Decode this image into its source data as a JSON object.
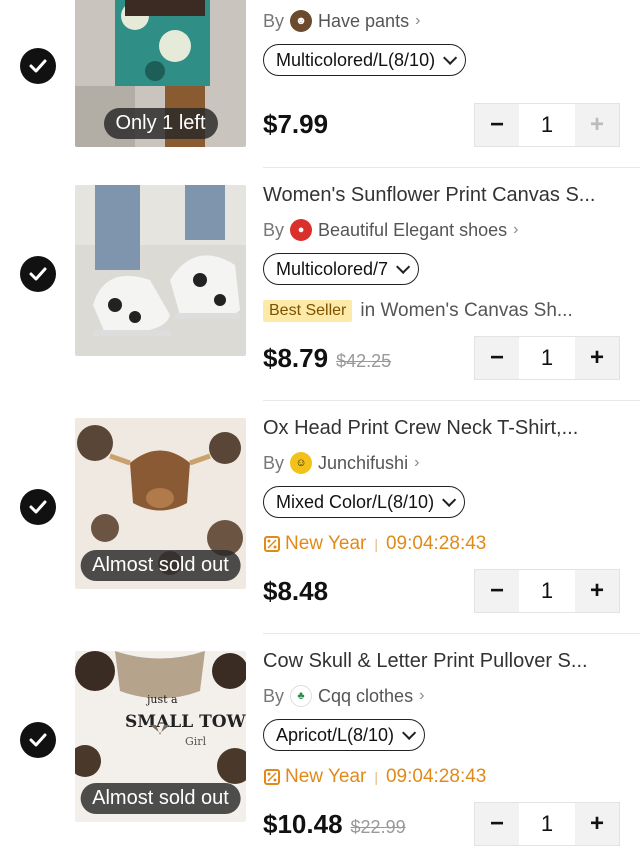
{
  "items": [
    {
      "title": "",
      "store": "Have pants",
      "by_label": "By",
      "variant": "Multicolored/L(8/10)",
      "thumb_badge": "Only 1 left",
      "price": "$7.99",
      "was_price": "",
      "quantity": "1",
      "minus_disabled": false,
      "plus_disabled": true
    },
    {
      "title": "Women's Sunflower Print Canvas S...",
      "store": "Beautiful Elegant shoes",
      "by_label": "By",
      "variant": "Multicolored/7",
      "best_seller_badge": "Best Seller",
      "best_seller_category": "in Women's Canvas Sh...",
      "price": "$8.79",
      "was_price": "$42.25",
      "quantity": "1"
    },
    {
      "title": "Ox Head Print Crew Neck T-Shirt,...",
      "store": "Junchifushi",
      "by_label": "By",
      "variant": "Mixed Color/L(8/10)",
      "thumb_badge": "Almost sold out",
      "promo_label": "New Year",
      "promo_timer": "09:04:28:43",
      "price": "$8.48",
      "was_price": "",
      "quantity": "1"
    },
    {
      "title": "Cow Skull & Letter Print Pullover S...",
      "store": "Cqq clothes",
      "by_label": "By",
      "variant": "Apricot/L(8/10)",
      "thumb_badge": "Almost sold out",
      "promo_label": "New Year",
      "promo_timer": "09:04:28:43",
      "price": "$10.48",
      "was_price": "$22.99",
      "quantity": "1",
      "shirt_text_1": "just a",
      "shirt_text_2": "SMALL TOWN",
      "shirt_text_3": "Girl"
    }
  ],
  "icons": {
    "check": "check-icon",
    "minus": "minus-icon",
    "plus": "plus-icon",
    "chevron": "chevron-right-icon",
    "promo": "discount-tag-icon"
  },
  "colors": {
    "promo": "#e08a1a",
    "best_seller_bg": "#fde9a8",
    "check_bg": "#111111"
  }
}
